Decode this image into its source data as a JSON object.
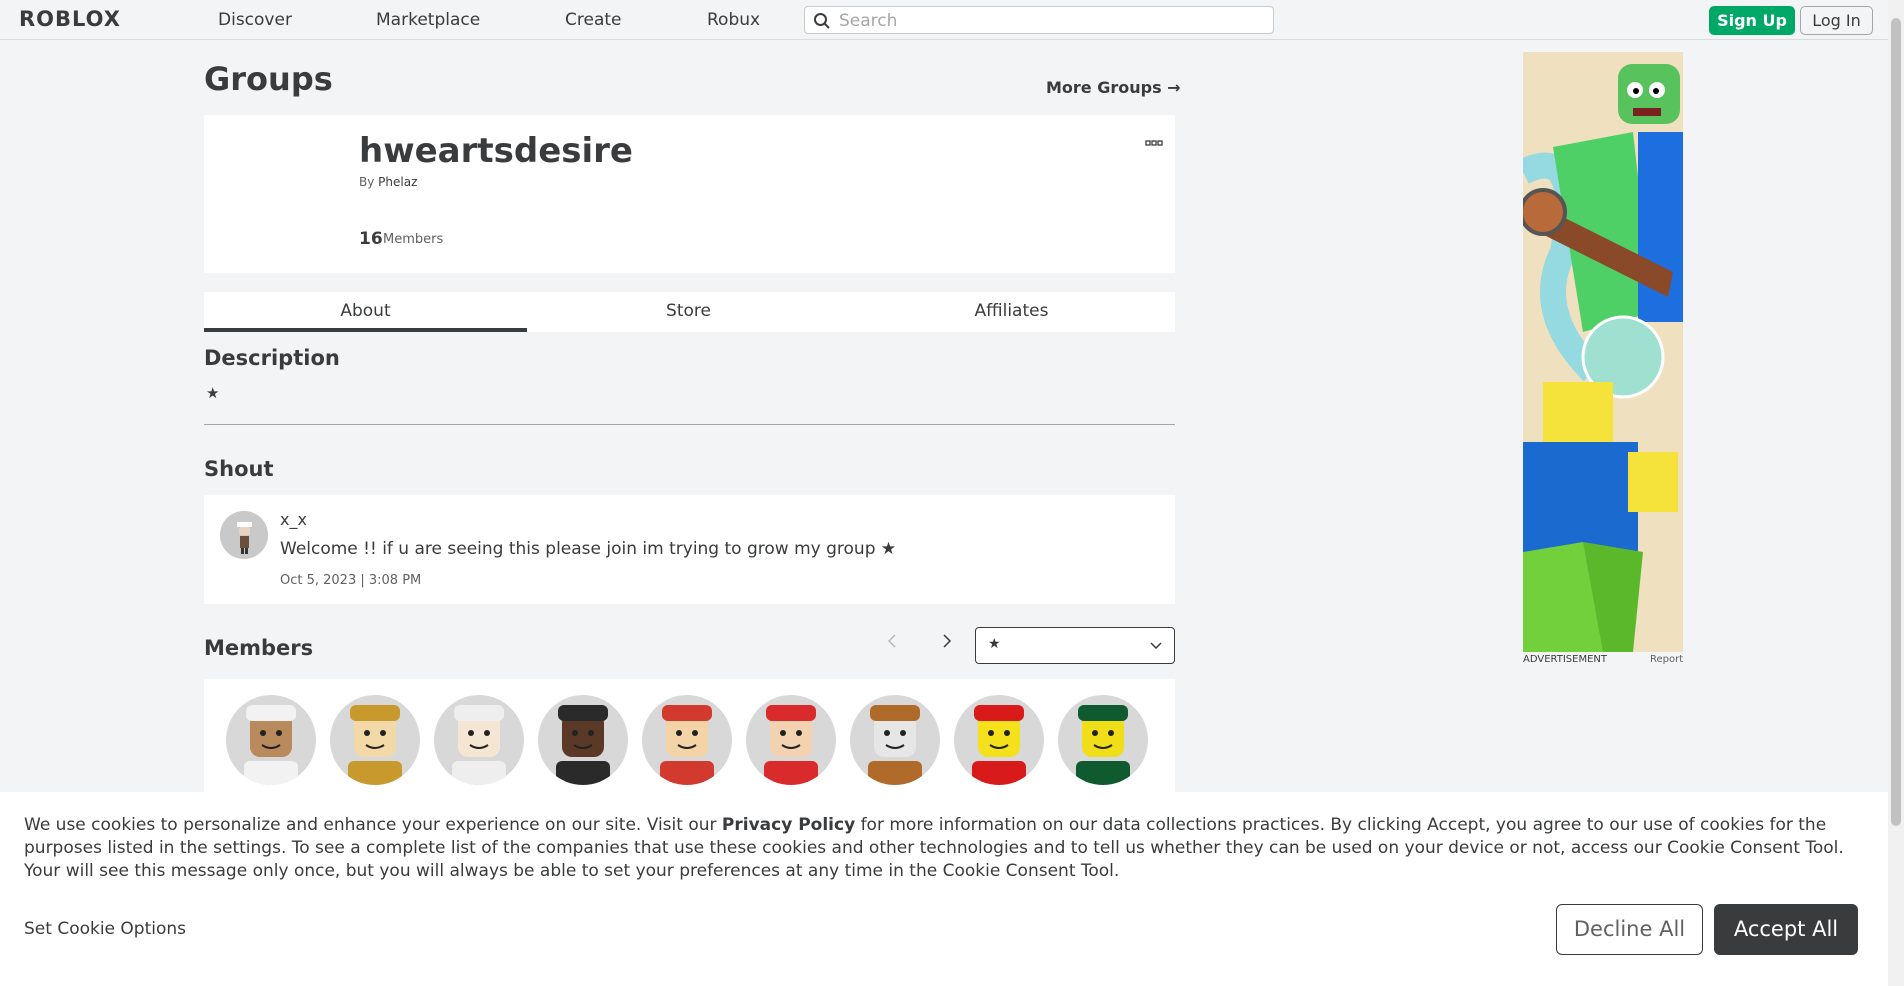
{
  "nav": {
    "logo": "ROBLOX",
    "links": [
      "Discover",
      "Marketplace",
      "Create",
      "Robux"
    ],
    "search_placeholder": "Search",
    "signup": "Sign Up",
    "login": "Log In"
  },
  "page": {
    "title": "Groups",
    "more_groups": "More Groups →"
  },
  "group": {
    "name": "hweartsdesire",
    "by_label": "By",
    "owner": "Phelaz",
    "member_count": "16",
    "members_label": "Members",
    "more_icon": "ellipsis-icon"
  },
  "tabs": [
    "About",
    "Store",
    "Affiliates"
  ],
  "description": {
    "title": "Description",
    "text": "★"
  },
  "shout": {
    "title": "Shout",
    "user": "x_x",
    "message": "Welcome !! if u are seeing this please join im trying to grow my group ★",
    "date": "Oct 5, 2023 | 3:08 PM"
  },
  "members": {
    "title": "Members",
    "role_selected": "★",
    "avatars": [
      {
        "bg": "#d8d8d8",
        "skin": "#b98a5b",
        "hair": "#f2f2f2"
      },
      {
        "bg": "#d8d8d8",
        "skin": "#f3d9a7",
        "hair": "#c89a2e"
      },
      {
        "bg": "#d8d8d8",
        "skin": "#f4e6d3",
        "hair": "#eeeeee"
      },
      {
        "bg": "#d8d8d8",
        "skin": "#5a3a26",
        "hair": "#2a2a2a"
      },
      {
        "bg": "#d8d8d8",
        "skin": "#f4d3a6",
        "hair": "#d23a2e"
      },
      {
        "bg": "#d8d8d8",
        "skin": "#f2d2b0",
        "hair": "#d92b2b"
      },
      {
        "bg": "#d8d8d8",
        "skin": "#e6e6e6",
        "hair": "#b06a2a"
      },
      {
        "bg": "#d8d8d8",
        "skin": "#f5e01c",
        "hair": "#d81a1a"
      },
      {
        "bg": "#d8d8d8",
        "skin": "#f0de18",
        "hair": "#0f5a2f"
      }
    ]
  },
  "ad": {
    "label": "ADVERTISEMENT",
    "report": "Report"
  },
  "cookie": {
    "text_before": "We use cookies to personalize and enhance your experience on our site. Visit our ",
    "privacy_link": "Privacy Policy",
    "text_after": " for more information on our data collections practices. By clicking Accept, you agree to our use of cookies for the purposes listed in the settings. To see a complete list of the companies that use these cookies and other technologies and to tell us whether they can be used on your device or not, access our Cookie Consent Tool. Your will see this message only once, but you will always be able to set your preferences at any time in the Cookie Consent Tool.",
    "options": "Set Cookie Options",
    "decline": "Decline All",
    "accept": "Accept All"
  },
  "colors": {
    "accent_green": "#00a867",
    "text_dark": "#393b3d",
    "bg": "#f2f4f5"
  }
}
